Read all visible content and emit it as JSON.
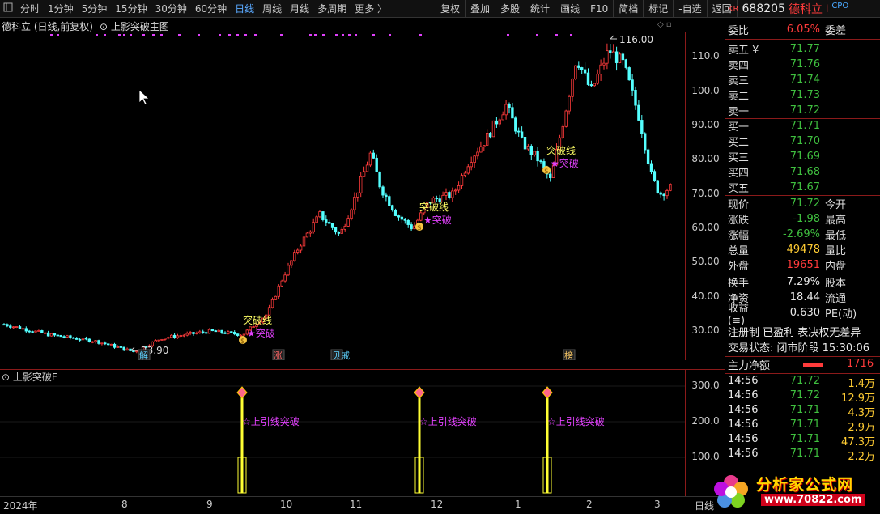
{
  "toolbar": {
    "periods": [
      "分时",
      "1分钟",
      "5分钟",
      "15分钟",
      "30分钟",
      "60分钟",
      "日线",
      "周线",
      "月线",
      "多周期",
      "更多 〉"
    ],
    "active_period": "日线",
    "buttons": [
      "复权",
      "叠加",
      "多股",
      "统计",
      "画线",
      "F10",
      "简档",
      "标记",
      "-自选",
      "返回"
    ]
  },
  "stock": {
    "market_tag": "KR",
    "code": "688205",
    "name": "德科立",
    "cpo_tag": "CPO"
  },
  "main_chart": {
    "title": "德科立 (日线,前复权)",
    "indicator": "上影突破主图",
    "high_label": "116.00",
    "low_label": "23.90",
    "labels": [
      "突破线",
      "突破",
      "突破线",
      "突破",
      "突破线",
      "突破"
    ],
    "markers": [
      "解",
      "涨",
      "贝戚",
      "榜"
    ]
  },
  "y_axis": [
    "110.0",
    "100.0",
    "90.00",
    "80.00",
    "70.00",
    "60.00",
    "50.00",
    "40.00",
    "30.00"
  ],
  "sub_chart": {
    "title": "上影突破F",
    "signal_label": "上引线突破",
    "y_axis": [
      "300.0",
      "200.0",
      "100.0"
    ]
  },
  "x_axis": [
    "2024年",
    "8",
    "9",
    "10",
    "11",
    "12",
    "1",
    "2",
    "3",
    "日线"
  ],
  "quote": {
    "weibi_label": "委比",
    "weibi_value": "6.05%",
    "weicha_label": "委差",
    "asks": [
      {
        "label": "卖五 ¥",
        "price": "71.77"
      },
      {
        "label": "卖四",
        "price": "71.76"
      },
      {
        "label": "卖三",
        "price": "71.74"
      },
      {
        "label": "卖二",
        "price": "71.73"
      },
      {
        "label": "卖一",
        "price": "71.72"
      }
    ],
    "bids": [
      {
        "label": "买一",
        "price": "71.71"
      },
      {
        "label": "买二",
        "price": "71.70"
      },
      {
        "label": "买三",
        "price": "71.69"
      },
      {
        "label": "买四",
        "price": "71.68"
      },
      {
        "label": "买五",
        "price": "71.67"
      }
    ],
    "stats": [
      {
        "label": "现价",
        "value": "71.72",
        "label2": "今开",
        "color": "green"
      },
      {
        "label": "涨跌",
        "value": "-1.98",
        "label2": "最高",
        "color": "green"
      },
      {
        "label": "涨幅",
        "value": "-2.69%",
        "label2": "最低",
        "color": "green"
      },
      {
        "label": "总量",
        "value": "49478",
        "label2": "量比",
        "color": "yellow"
      },
      {
        "label": "外盘",
        "value": "19651",
        "label2": "内盘",
        "color": "red"
      }
    ],
    "stats2": [
      {
        "label": "换手",
        "value": "7.29%",
        "label2": "股本"
      },
      {
        "label": "净资",
        "value": "18.44",
        "label2": "流通"
      },
      {
        "label": "收益(≡)",
        "value": "0.630",
        "label2": "PE(动)"
      }
    ],
    "notice": "注册制 已盈利 表决权无差异",
    "trade_status": "交易状态: 闭市阶段 15:30:06",
    "main_flow_label": "主力净额",
    "main_flow_value": "1716",
    "ticks": [
      {
        "time": "14:56",
        "price": "71.72",
        "vol": "1.4万"
      },
      {
        "time": "14:56",
        "price": "71.72",
        "vol": "12.9万"
      },
      {
        "time": "14:56",
        "price": "71.71",
        "vol": "4.3万"
      },
      {
        "time": "14:56",
        "price": "71.71",
        "vol": "2.9万"
      },
      {
        "time": "14:56",
        "price": "71.71",
        "vol": "47.3万"
      },
      {
        "time": "14:56",
        "price": "71.71",
        "vol": "2.2万"
      }
    ]
  },
  "watermark": {
    "text": "分析家公式网",
    "url": "www.70822.com"
  }
}
